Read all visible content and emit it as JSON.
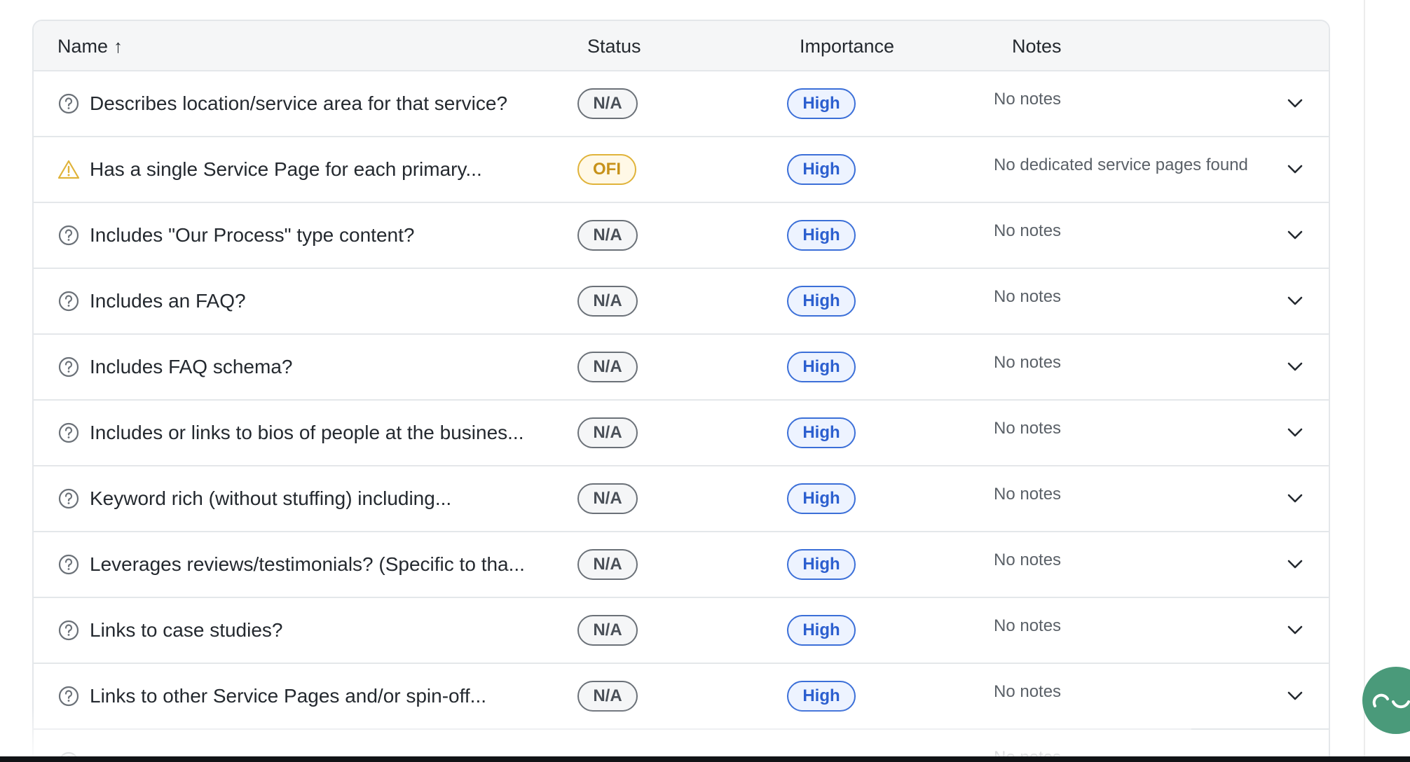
{
  "table": {
    "columns": {
      "name": "Name",
      "sort_indicator": "↑",
      "status": "Status",
      "importance": "Importance",
      "notes": "Notes"
    },
    "rows": [
      {
        "icon": "help-circle-icon",
        "name": "Describes location/service area for that service?",
        "status": "N/A",
        "importance": "High",
        "notes": "No notes"
      },
      {
        "icon": "warning-triangle-icon",
        "name": "Has a single Service Page for each primary...",
        "status": "OFI",
        "importance": "High",
        "notes": "No dedicated service pages found"
      },
      {
        "icon": "help-circle-icon",
        "name": "Includes \"Our Process\" type content?",
        "status": "N/A",
        "importance": "High",
        "notes": "No notes"
      },
      {
        "icon": "help-circle-icon",
        "name": "Includes an FAQ?",
        "status": "N/A",
        "importance": "High",
        "notes": "No notes"
      },
      {
        "icon": "help-circle-icon",
        "name": "Includes FAQ schema?",
        "status": "N/A",
        "importance": "High",
        "notes": "No notes"
      },
      {
        "icon": "help-circle-icon",
        "name": "Includes or links to bios of people at the busines...",
        "status": "N/A",
        "importance": "High",
        "notes": "No notes"
      },
      {
        "icon": "help-circle-icon",
        "name": "Keyword rich (without stuffing) including...",
        "status": "N/A",
        "importance": "High",
        "notes": "No notes"
      },
      {
        "icon": "help-circle-icon",
        "name": "Leverages reviews/testimonials? (Specific to tha...",
        "status": "N/A",
        "importance": "High",
        "notes": "No notes"
      },
      {
        "icon": "help-circle-icon",
        "name": "Links to case studies?",
        "status": "N/A",
        "importance": "High",
        "notes": "No notes"
      },
      {
        "icon": "help-circle-icon",
        "name": "Links to other Service Pages and/or spin-off...",
        "status": "N/A",
        "importance": "High",
        "notes": "No notes"
      },
      {
        "icon": "help-circle-icon",
        "name": "",
        "status": "",
        "importance": "",
        "notes": "No notes"
      }
    ]
  },
  "colors": {
    "status_na": "#6b7178",
    "status_ofi": "#e0b33a",
    "importance_high": "#3b6fd8",
    "chat_bubble": "#4a9a7a"
  }
}
